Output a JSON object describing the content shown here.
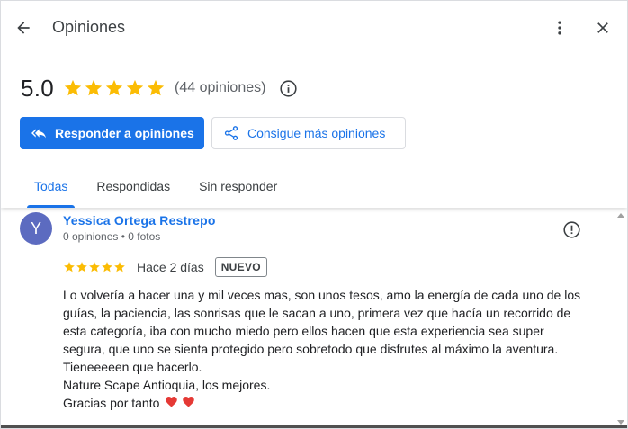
{
  "header": {
    "title": "Opiniones"
  },
  "summary": {
    "rating": "5.0",
    "stars": 5,
    "reviews_count": "(44 opiniones)"
  },
  "actions": {
    "reply_label": "Responder a opiniones",
    "get_more_label": "Consigue más opiniones"
  },
  "tabs": [
    {
      "label": "Todas",
      "active": true
    },
    {
      "label": "Respondidas",
      "active": false
    },
    {
      "label": "Sin responder",
      "active": false
    }
  ],
  "review": {
    "avatar_initial": "Y",
    "author": "Yessica Ortega Restrepo",
    "meta": "0 opiniones • 0 fotos",
    "stars": 5,
    "time": "Hace 2 días",
    "badge": "NUEVO",
    "lines": [
      "Lo volvería a hacer una y mil veces mas, son unos tesos, amo la energía de cada uno de los",
      "guías, la paciencia, las sonrisas que le sacan a uno, primera vez que hacía un recorrido de",
      "esta categoría, iba con mucho miedo pero ellos hacen que esta experiencia sea super",
      "segura, que uno se sienta protegido pero sobretodo que disfrutes al máximo la aventura.",
      "Tieneeeeen que hacerlo.",
      "Nature Scape Antioquia, los mejores.",
      "Gracias por tanto"
    ]
  },
  "colors": {
    "accent": "#1a73e8",
    "star": "#fbbc04",
    "avatar": "#5c6bc0",
    "heart": "#e53935"
  }
}
